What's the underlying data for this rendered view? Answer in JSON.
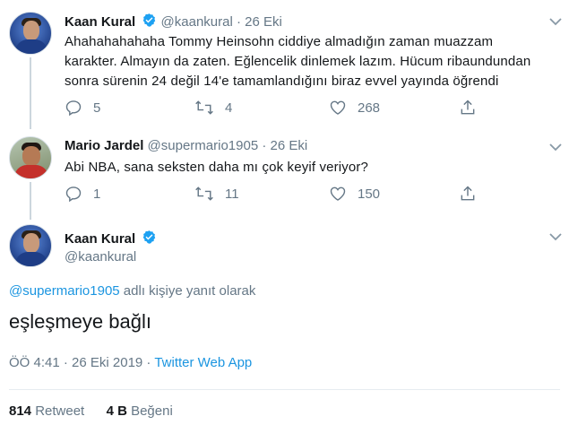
{
  "tweets": [
    {
      "name": "Kaan Kural",
      "handle": "@kaankural",
      "separator": "·",
      "date": "26 Eki",
      "lines": [
        "Ahahahahahaha Tommy Heinsohn ciddiye almadığın zaman muazzam",
        "karakter. Almayın da zaten. Eğlencelik dinlemek lazım. Hücum ribaundundan",
        "sonra sürenin 24 değil 14'e tamamlandığını biraz evvel yayında öğrendi"
      ],
      "replies": "5",
      "retweets": "4",
      "likes": "268"
    },
    {
      "name": "Mario Jardel",
      "handle": "@supermario1905",
      "separator": "·",
      "date": "26 Eki",
      "lines": [
        "Abi NBA, sana seksten daha mı çok keyif veriyor?"
      ],
      "replies": "1",
      "retweets": "11",
      "likes": "150"
    }
  ],
  "main": {
    "name": "Kaan Kural",
    "handle": "@kaankural",
    "reply_mention": "@supermario1905",
    "reply_suffix": " adlı kişiye yanıt olarak",
    "text": "eşleşmeye bağlı",
    "time": "ÖÖ 4:41 · 26 Eki 2019 · ",
    "source": "Twitter Web App",
    "retweet_count": "814",
    "retweet_label": " Retweet",
    "like_count": "4 B",
    "like_label": " Beğeni"
  },
  "icons": {
    "verified": "verified-badge-icon",
    "caret": "chevron-down-icon",
    "reply": "reply-icon",
    "retweet": "retweet-icon",
    "like": "heart-icon",
    "share": "share-icon"
  },
  "colors": {
    "link": "#1b95e0",
    "muted": "#657786",
    "verified": "#1da1f2",
    "text": "#14171a"
  }
}
